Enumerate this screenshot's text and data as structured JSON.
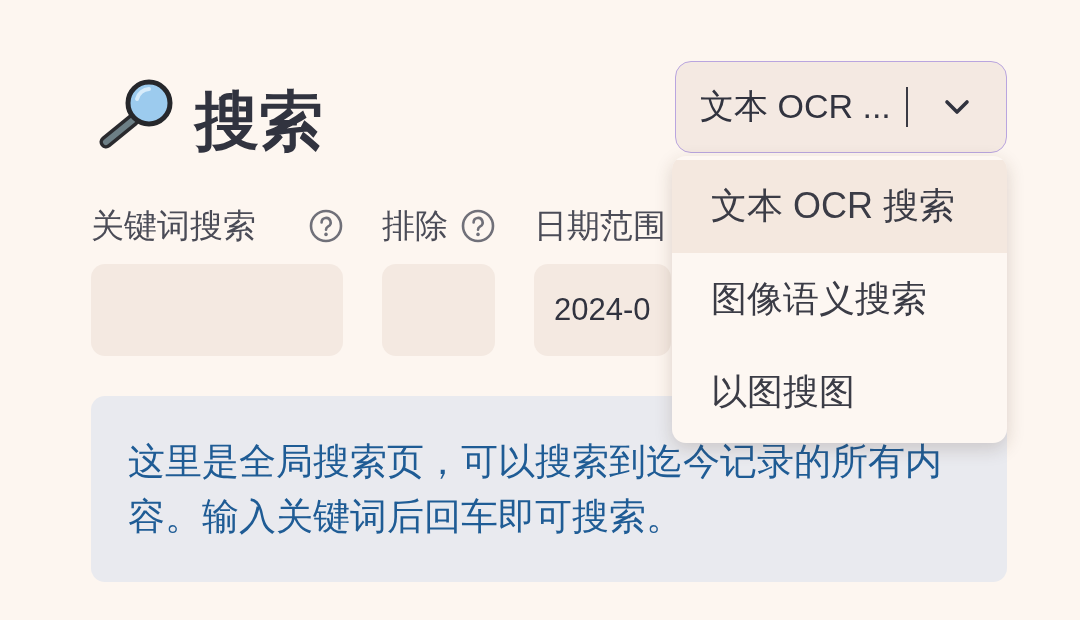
{
  "title": {
    "text": "搜索"
  },
  "search_mode": {
    "value": "文本 OCR ...",
    "expanded": true,
    "options": [
      {
        "label": "文本 OCR 搜索",
        "selected": true
      },
      {
        "label": "图像语义搜索",
        "selected": false
      },
      {
        "label": "以图搜图",
        "selected": false
      }
    ]
  },
  "filters": [
    {
      "label": "关键词搜索",
      "help": true
    },
    {
      "label": "排除",
      "help": true
    },
    {
      "label": "日期范围",
      "value": "2024-0"
    }
  ],
  "info": {
    "text": "这里是全局搜索页，可以搜索到迄今记录的所有内容。输入关键词后回车即可搜索。"
  }
}
